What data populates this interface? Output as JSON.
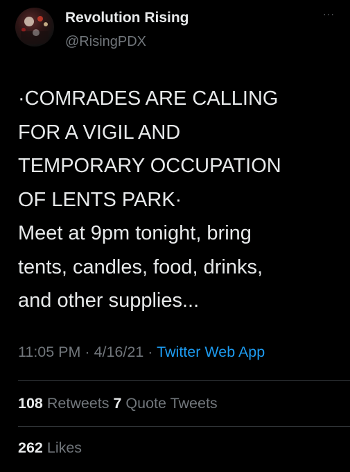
{
  "author": {
    "display_name": "Revolution Rising",
    "handle": "@RisingPDX",
    "avatar_icon": "profile-avatar-icon"
  },
  "menu": {
    "more_label": "···"
  },
  "tweet": {
    "text": "·COMRADES ARE CALLING\nFOR A VIGIL AND\nTEMPORARY OCCUPATION\nOF LENTS PARK·\nMeet at 9pm tonight, bring\ntents, candles, food, drinks,\nand other supplies..."
  },
  "meta": {
    "time": "11:05 PM",
    "separator": "·",
    "date": "4/16/21",
    "source": "Twitter Web App"
  },
  "stats": {
    "retweets_count": "108",
    "retweets_label": "Retweets",
    "quotes_count": "7",
    "quotes_label": "Quote Tweets",
    "likes_count": "262",
    "likes_label": "Likes"
  },
  "colors": {
    "background": "#000000",
    "text": "#e7e9ea",
    "secondary": "#71767b",
    "link": "#1d9bf0",
    "divider": "#2f3336"
  }
}
